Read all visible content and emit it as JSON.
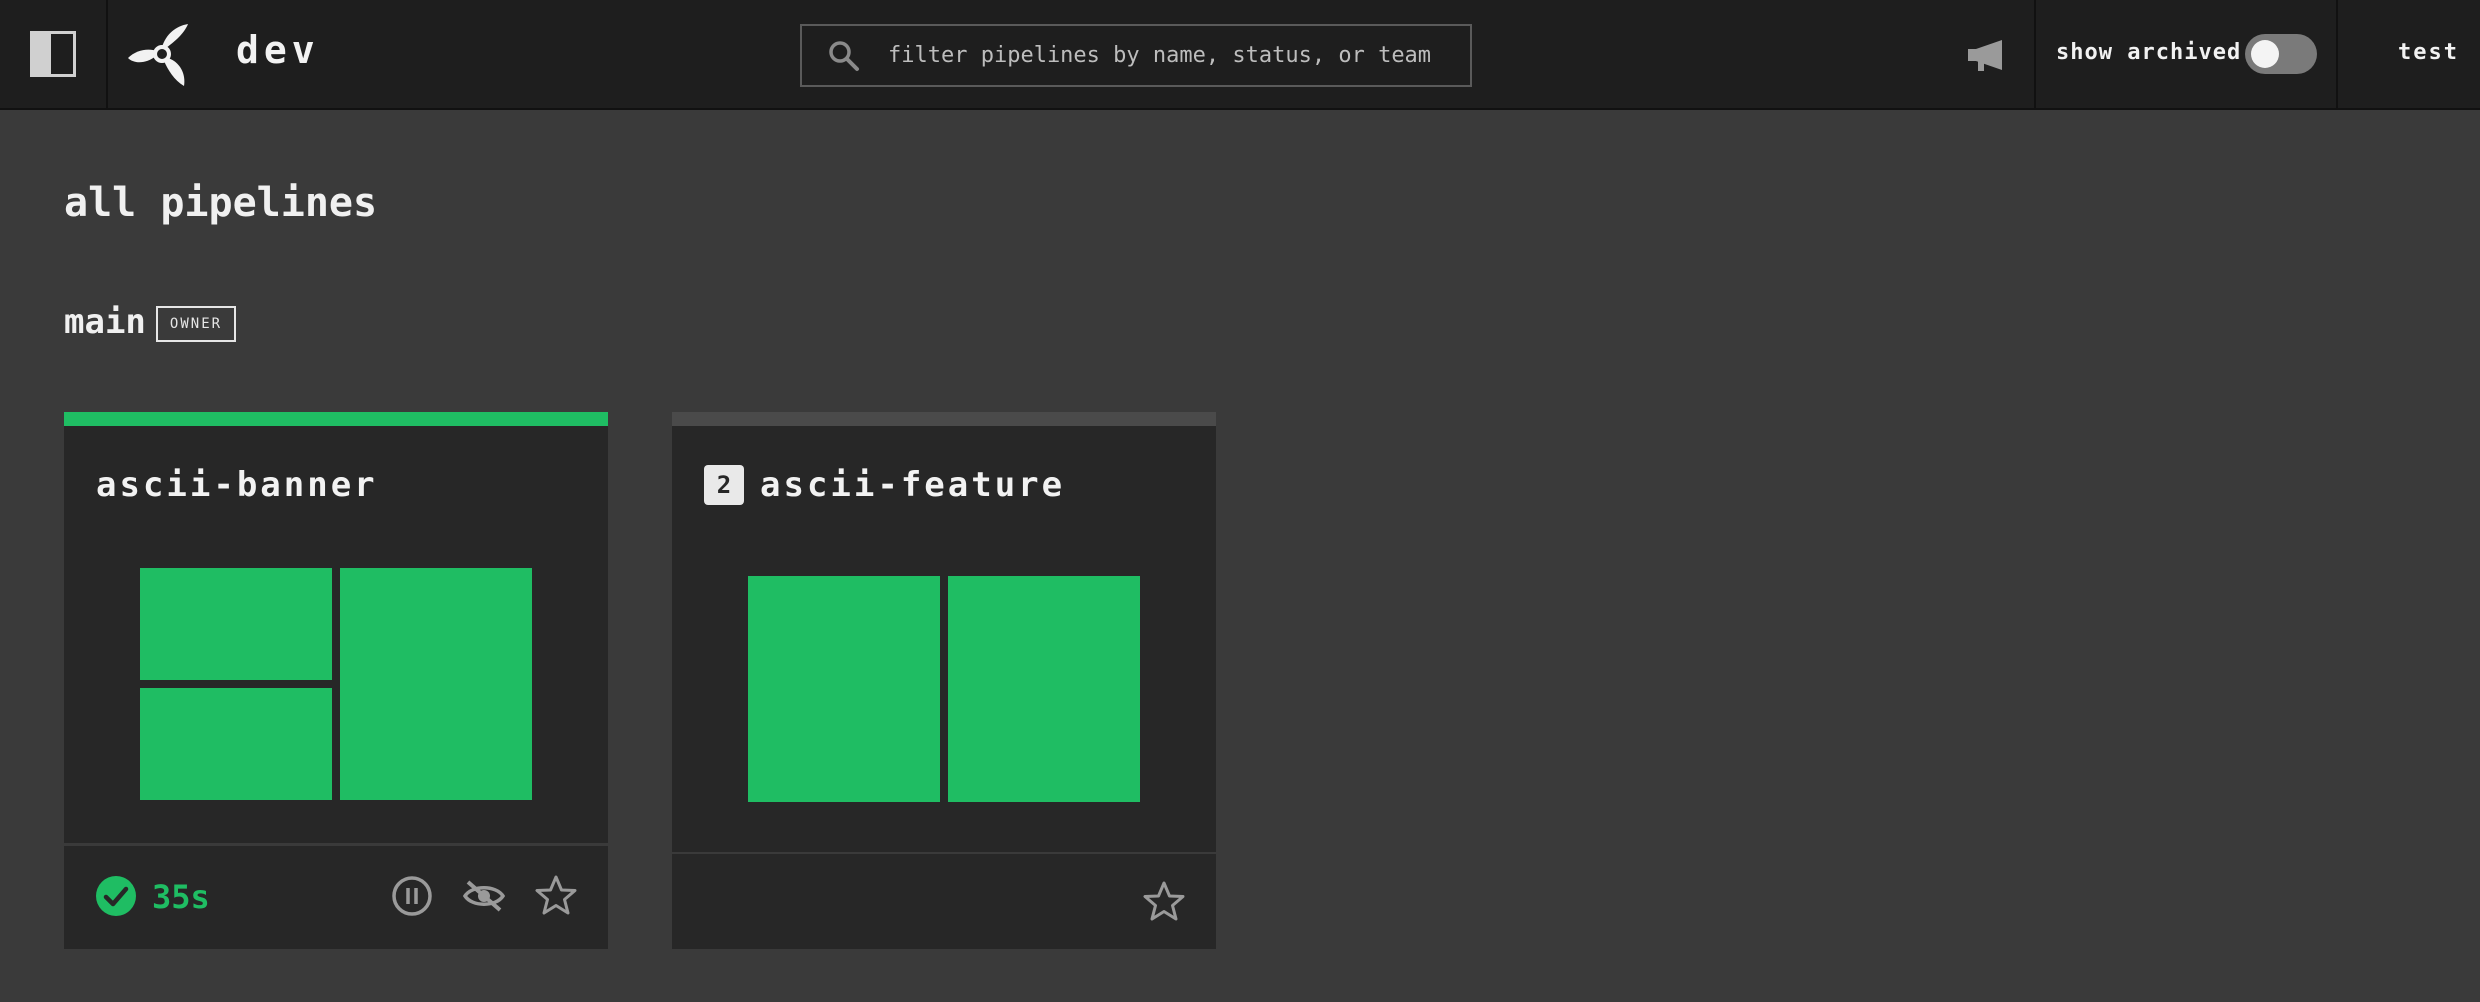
{
  "topbar": {
    "team_name": "dev",
    "search_placeholder": "filter pipelines by name, status, or team",
    "show_archived_label": "show archived",
    "show_archived_on": false,
    "user": "test"
  },
  "page": {
    "title": "all pipelines",
    "team": "main",
    "role_badge": "OWNER"
  },
  "pipelines": [
    {
      "name": "ascii-banner",
      "status": "succeeded",
      "status_color": "#1fbd63",
      "duration": "35s",
      "job_color": "#1fbd63"
    },
    {
      "name": "ascii-feature",
      "status": "pending",
      "status_color": "#4a4a4a",
      "instance_count": "2",
      "job_color": "#1fbd63"
    }
  ],
  "icons": {
    "sidebar": "sidebar-toggle-icon",
    "logo": "concourse-logo-icon",
    "search": "search-icon",
    "announce": "megaphone-icon",
    "success": "check-circle-icon",
    "pause": "pause-icon",
    "hide": "eye-slash-icon",
    "favorite": "star-icon"
  }
}
